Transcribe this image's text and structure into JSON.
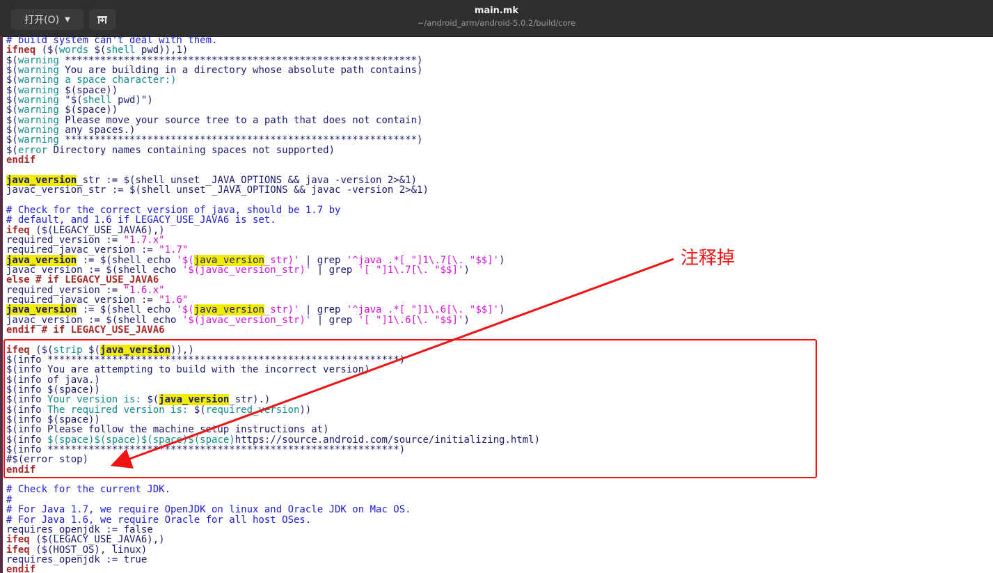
{
  "header": {
    "open_button": "打开(O)",
    "title": "main.mk",
    "path": "~/android_arm/android-5.0.2/build/core"
  },
  "annotation": {
    "text": "注释掉",
    "color": "#ee1414"
  },
  "colors": {
    "keyword": "#a52a2a",
    "comment": "#1c1cd4",
    "function": "#0d8a8a",
    "string": "#d60fd6",
    "highlight": "#f2ec00",
    "default": "#1a1a6e"
  },
  "icons": {
    "open_menu": "chevron-down-icon",
    "pin": "pin-new-tab-icon"
  },
  "code_lines": [
    [
      [
        "# build system can't deal with them.",
        "cm"
      ]
    ],
    [
      [
        "ifneq",
        "kw"
      ],
      [
        " ($("
      ],
      [
        "words",
        "fn"
      ],
      [
        " $("
      ],
      [
        "shell",
        "fn"
      ],
      [
        " pwd)),1)"
      ]
    ],
    [
      [
        "$("
      ],
      [
        "warning",
        "fn"
      ],
      [
        " ************************************************************)"
      ]
    ],
    [
      [
        "$("
      ],
      [
        "warning",
        "fn"
      ],
      [
        " You are building in a directory whose absolute path contains)"
      ]
    ],
    [
      [
        "$("
      ],
      [
        "warning",
        "fn"
      ],
      [
        " a space character:)",
        "fn"
      ]
    ],
    [
      [
        "$("
      ],
      [
        "warning",
        "fn"
      ],
      [
        " $(space))"
      ]
    ],
    [
      [
        "$("
      ],
      [
        "warning",
        "fn"
      ],
      [
        " \"$("
      ],
      [
        "shell",
        "fn"
      ],
      [
        " pwd)\")"
      ]
    ],
    [
      [
        "$("
      ],
      [
        "warning",
        "fn"
      ],
      [
        " $(space))"
      ]
    ],
    [
      [
        "$("
      ],
      [
        "warning",
        "fn"
      ],
      [
        " Please move your source tree to a path that does not contain)"
      ]
    ],
    [
      [
        "$("
      ],
      [
        "warning",
        "fn"
      ],
      [
        " any spaces.)"
      ]
    ],
    [
      [
        "$("
      ],
      [
        "warning",
        "fn"
      ],
      [
        " ************************************************************)"
      ]
    ],
    [
      [
        "$("
      ],
      [
        "error",
        "fn"
      ],
      [
        " Directory names containing spaces not supported)"
      ]
    ],
    [
      [
        "endif",
        "kw"
      ]
    ],
    [],
    [
      [
        "java_version",
        "hlb"
      ],
      [
        "_str := $(shell unset _JAVA_OPTIONS && java -version 2>&1)"
      ]
    ],
    [
      [
        "javac_version_str := $(shell unset _JAVA_OPTIONS && javac -version 2>&1)"
      ]
    ],
    [],
    [
      [
        "# Check for the correct version of java, should be 1.7 by",
        "cm"
      ]
    ],
    [
      [
        "# default, and 1.6 if LEGACY_USE_JAVA6 is set.",
        "cm"
      ]
    ],
    [
      [
        "ifeq",
        "kw"
      ],
      [
        " ($(LEGACY_USE_JAVA6),)"
      ]
    ],
    [
      [
        "required_version := "
      ],
      [
        "\"1.7.x\"",
        "str"
      ]
    ],
    [
      [
        "required_javac_version := "
      ],
      [
        "\"1.7\"",
        "str"
      ]
    ],
    [
      [
        "java_version",
        "hlb"
      ],
      [
        " := $(shell echo "
      ],
      [
        "'$(",
        "str"
      ],
      [
        "java_version",
        "hl"
      ],
      [
        "_str)'",
        "str"
      ],
      [
        " | grep "
      ],
      [
        "'^java .*[ \"]1\\.7[\\. \"$$]'",
        "str"
      ],
      [
        ")"
      ]
    ],
    [
      [
        "javac_version := $(shell echo "
      ],
      [
        "'$(javac_version_str)'",
        "str"
      ],
      [
        " | grep "
      ],
      [
        "'[ \"]1\\.7[\\. \"$$]'",
        "str"
      ],
      [
        ")"
      ]
    ],
    [
      [
        "else # if LEGACY_USE_JAVA6",
        "kw"
      ]
    ],
    [
      [
        "required_version := "
      ],
      [
        "\"1.6.x\"",
        "str"
      ]
    ],
    [
      [
        "required_javac_version := "
      ],
      [
        "\"1.6\"",
        "str"
      ]
    ],
    [
      [
        "java_version",
        "hlb"
      ],
      [
        " := $(shell echo "
      ],
      [
        "'$(",
        "str"
      ],
      [
        "java_version",
        "hl"
      ],
      [
        "_str)'",
        "str"
      ],
      [
        " | grep "
      ],
      [
        "'^java .*[ \"]1\\.6[\\. \"$$]'",
        "str"
      ],
      [
        ")"
      ]
    ],
    [
      [
        "javac_version := $(shell echo "
      ],
      [
        "'$(javac_version_str)'",
        "str"
      ],
      [
        " | grep "
      ],
      [
        "'[ \"]1\\.6[\\. \"$$]'",
        "str"
      ],
      [
        ")"
      ]
    ],
    [
      [
        "endif # if LEGACY_USE_JAVA6",
        "kw"
      ]
    ],
    [],
    [
      [
        "ifeq",
        "kw"
      ],
      [
        " ($("
      ],
      [
        "strip",
        "fn"
      ],
      [
        " $("
      ],
      [
        "java_version",
        "hlb"
      ],
      [
        ")),)"
      ]
    ],
    [
      [
        "$(info ************************************************************)"
      ]
    ],
    [
      [
        "$(info You are attempting to build with the incorrect version)"
      ]
    ],
    [
      [
        "$(info of java.)"
      ]
    ],
    [
      [
        "$(info $(space))"
      ]
    ],
    [
      [
        "$(info "
      ],
      [
        "Your version is: ",
        "fn"
      ],
      [
        "$("
      ],
      [
        "java_version",
        "hlb"
      ],
      [
        "_str).)"
      ]
    ],
    [
      [
        "$(info "
      ],
      [
        "The required version is: ",
        "fn"
      ],
      [
        "$("
      ],
      [
        "required_version",
        "fn"
      ],
      [
        "))"
      ]
    ],
    [
      [
        "$(info $(space))"
      ]
    ],
    [
      [
        "$(info Please follow the machine setup instructions at)"
      ]
    ],
    [
      [
        "$(info "
      ],
      [
        "$(space)$(space)$(space)$(space)",
        "fn"
      ],
      [
        "https://source.android.com/source/initializing.html)"
      ]
    ],
    [
      [
        "$(info ************************************************************)"
      ]
    ],
    [
      [
        "#$(error stop)"
      ]
    ],
    [
      [
        "endif",
        "kw"
      ]
    ],
    [],
    [
      [
        "# Check for the current JDK.",
        "cm"
      ]
    ],
    [
      [
        "#",
        "cm"
      ]
    ],
    [
      [
        "# For Java 1.7, we require OpenJDK on linux and Oracle JDK on Mac OS.",
        "cm"
      ]
    ],
    [
      [
        "# For Java 1.6, we require Oracle for all host OSes.",
        "cm"
      ]
    ],
    [
      [
        "requires_openjdk := false"
      ]
    ],
    [
      [
        "ifeq",
        "kw"
      ],
      [
        " ($(LEGACY_USE_JAVA6),)"
      ]
    ],
    [
      [
        "ifeq",
        "kw"
      ],
      [
        " ($(HOST_OS), linux)"
      ]
    ],
    [
      [
        "requires_openjdk := true"
      ]
    ],
    [
      [
        "endif",
        "kw"
      ]
    ]
  ]
}
